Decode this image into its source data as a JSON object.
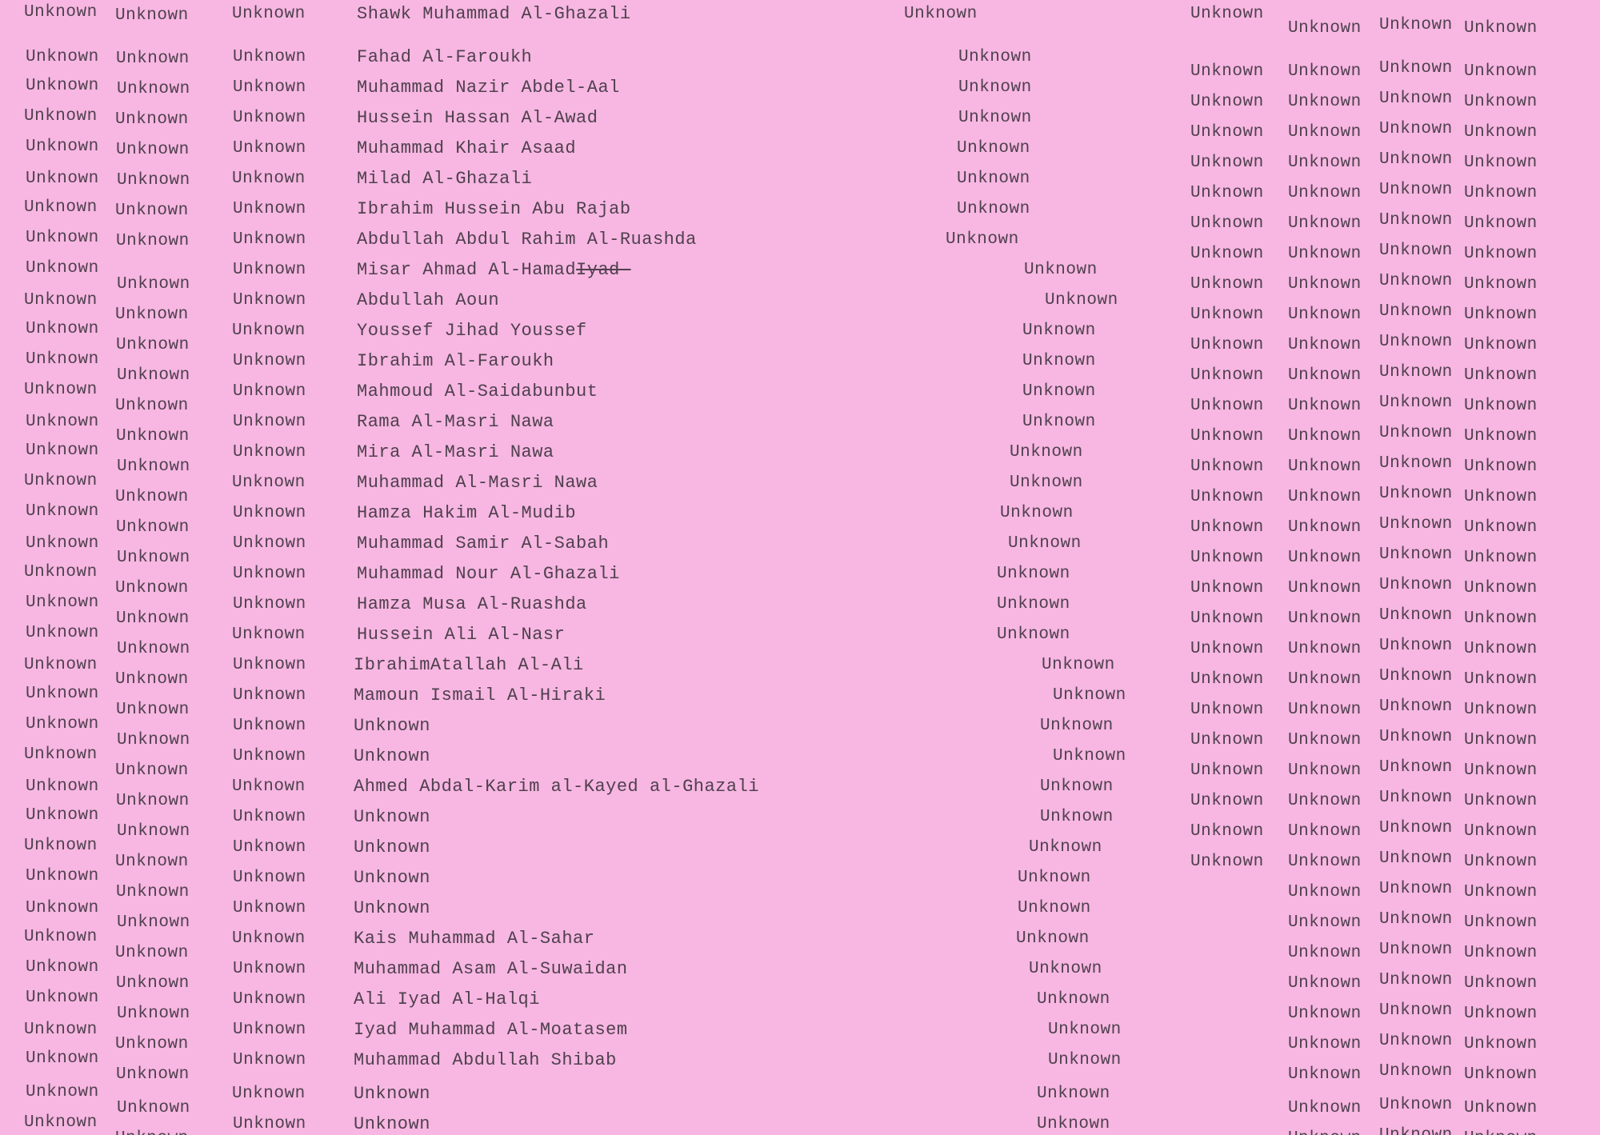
{
  "document": {
    "placeholder": "Unknown",
    "strike_text": "Iyad-",
    "names": [
      "Shawk Muhammad Al-Ghazali",
      "Fahad Al-Faroukh",
      "Muhammad Nazir Abdel-Aal",
      "Hussein Hassan Al-Awad",
      "Muhammad Khair Asaad",
      "Milad Al-Ghazali",
      "Ibrahim Hussein Abu Rajab",
      "Abdullah Abdul Rahim Al-Ruashda",
      "Misar Ahmad Al-Hamad",
      "Abdullah Aoun",
      "Youssef Jihad Youssef",
      "Ibrahim Al-Faroukh",
      "Mahmoud Al-Saidabunbut",
      "Rama Al-Masri Nawa",
      "Mira Al-Masri Nawa",
      "Muhammad Al-Masri Nawa",
      "Hamza Hakim Al-Mudib",
      "Muhammad Samir Al-Sabah",
      "Muhammad Nour Al-Ghazali",
      "Hamza Musa Al-Ruashda",
      "Hussein Ali Al-Nasr",
      "IbrahimAtallah Al-Ali",
      "Mamoun Ismail Al-Hiraki",
      "Unknown",
      "Unknown",
      "Ahmed Abdal-Karim al-Kayed al-Ghazali",
      "Unknown",
      "Unknown",
      "Unknown",
      "Unknown",
      "Kais Muhammad Al-Sahar",
      "Muhammad Asam Al-Suwaidan",
      "Ali Iyad Al-Halqi",
      "Iyad Muhammad Al-Moatasem",
      "Muhammad Abdullah Shibab",
      "Unknown",
      "Unknown"
    ],
    "colors": {
      "paper": "#f7b7e2",
      "ink": "#50404e"
    }
  }
}
